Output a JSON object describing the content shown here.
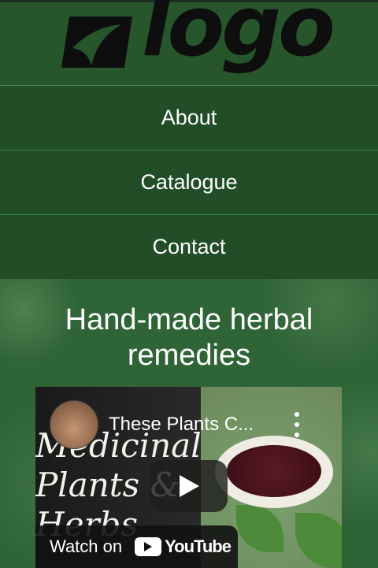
{
  "header": {
    "logo_text": "logo"
  },
  "nav": {
    "items": [
      {
        "label": "About"
      },
      {
        "label": "Catalogue"
      },
      {
        "label": "Contact"
      }
    ]
  },
  "hero": {
    "title": "Hand-made herbal remedies"
  },
  "video": {
    "title": "These Plants C...",
    "book_text_lines": [
      "Medicinal",
      "Plants &",
      "Herbs"
    ],
    "watch_on_label": "Watch on",
    "platform_name": "YouTube",
    "icons": {
      "more": "more-vertical-icon",
      "play": "play-icon",
      "platform": "youtube-logo-icon"
    }
  },
  "colors": {
    "header_bg": "#27562c",
    "nav_bg": "#214d27",
    "hero_bg": "#2f6437",
    "divider": "#3c8841",
    "text": "#ffffff"
  }
}
